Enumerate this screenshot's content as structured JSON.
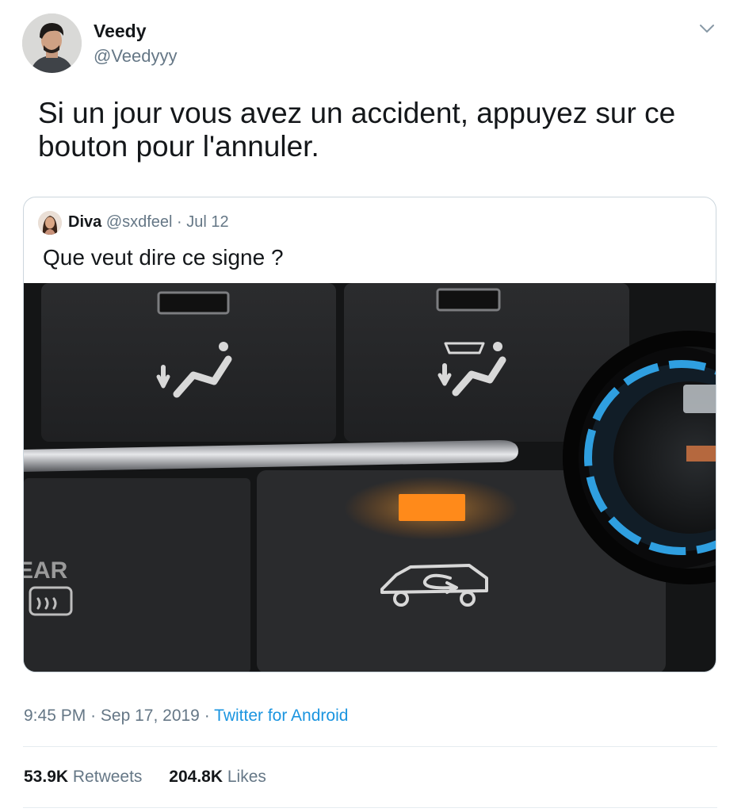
{
  "author": {
    "name": "Veedy",
    "handle": "@Veedyyy"
  },
  "tweet": {
    "text": "Si un jour vous avez un accident, appuyez sur ce bouton pour l'annuler."
  },
  "quoted": {
    "name": "Diva",
    "handle": "@sxdfeel",
    "separator": "·",
    "date": "Jul 12",
    "text": "Que veut dire ce signe ?",
    "photo_labels": {
      "rear": "EAR"
    }
  },
  "meta": {
    "time": "9:45 PM",
    "separator": "·",
    "date": "Sep 17, 2019",
    "source": "Twitter for Android"
  },
  "stats": {
    "retweets_count": "53.9K",
    "retweets_label": "Retweets",
    "likes_count": "204.8K",
    "likes_label": "Likes"
  },
  "colors": {
    "text_primary": "#14171a",
    "text_secondary": "#657786",
    "link": "#1b95e0",
    "border": "#ccd6dd",
    "indicator": "#ff8a1a"
  },
  "icons": {
    "caret": "chevron-down-icon",
    "recirculation": "air-recirculation-icon",
    "defrost": "rear-defrost-icon",
    "vent": "air-vent-icon"
  }
}
